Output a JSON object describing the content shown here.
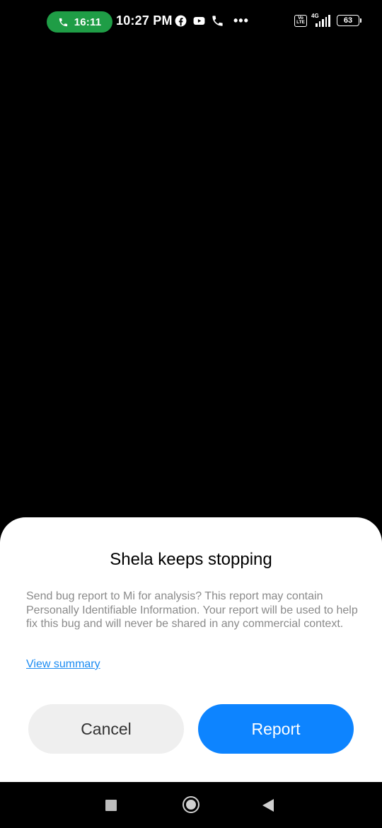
{
  "status_bar": {
    "call_timer": "16:11",
    "time": "10:27 PM",
    "notification_icons": [
      "facebook-icon",
      "youtube-icon",
      "phone-icon"
    ],
    "more": "•••",
    "volte_top": "Vo",
    "volte_bottom": "LTE",
    "network": "4G",
    "battery": "63"
  },
  "dialog": {
    "title": "Shela keeps stopping",
    "message": "Send bug report to Mi for analysis? This report may contain Personally Identifiable Information. Your report will be used to help fix this bug and will never be shared in any commercial context.",
    "link": "View summary",
    "cancel_label": "Cancel",
    "report_label": "Report",
    "accent_color": "#0d84ff"
  },
  "nav_bar": {
    "buttons": [
      "recents",
      "home",
      "back"
    ]
  }
}
